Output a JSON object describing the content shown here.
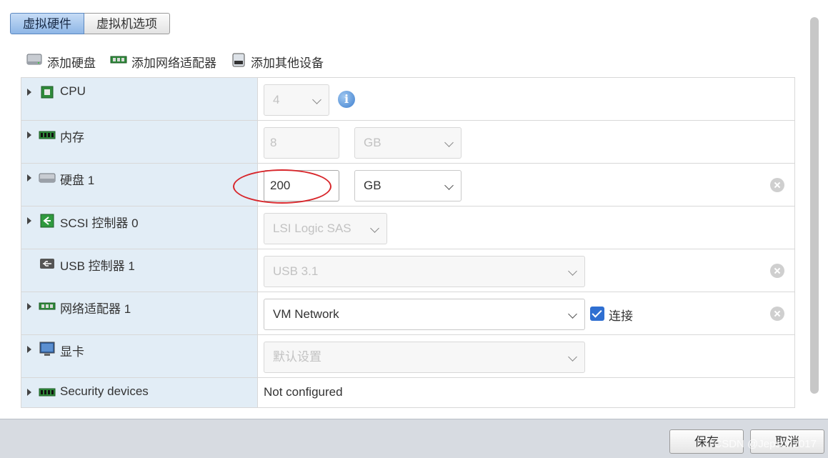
{
  "tabs": [
    {
      "label": "虚拟硬件"
    },
    {
      "label": "虚拟机选项"
    }
  ],
  "toolbar": {
    "add_disk": "添加硬盘",
    "add_nic": "添加网络适配器",
    "add_other": "添加其他设备"
  },
  "devices": {
    "cpu": {
      "label": "CPU",
      "value": "4"
    },
    "memory": {
      "label": "内存",
      "value": "8",
      "unit": "GB"
    },
    "disk": {
      "label": "硬盘 1",
      "value": "200",
      "unit": "GB"
    },
    "scsi": {
      "label": "SCSI 控制器 0",
      "value": "LSI Logic SAS"
    },
    "usb": {
      "label": "USB 控制器 1",
      "value": "USB 3.1"
    },
    "nic": {
      "label": "网络适配器 1",
      "value": "VM Network",
      "connect_label": "连接",
      "connected": true
    },
    "video": {
      "label": "显卡",
      "value": "默认设置"
    },
    "security": {
      "label": "Security devices",
      "value": "Not configured"
    }
  },
  "footer": {
    "save": "保存",
    "cancel": "取消",
    "watermark": "CSDN @Jepson2017"
  },
  "colors": {
    "label_bg": "#e2edf6",
    "active_tab": "#8eb6e6",
    "checkbox": "#2f6fd1",
    "highlight_circle": "#d8262b"
  }
}
